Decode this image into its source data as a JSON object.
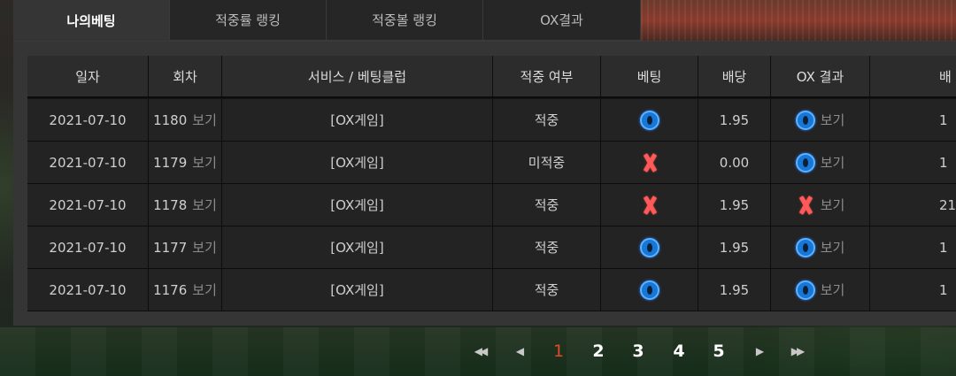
{
  "tabs": [
    {
      "label": "나의베팅",
      "active": true
    },
    {
      "label": "적중률 랭킹",
      "active": false
    },
    {
      "label": "적중볼 랭킹",
      "active": false
    },
    {
      "label": "OX결과",
      "active": false
    }
  ],
  "table": {
    "headers": [
      "일자",
      "회차",
      "서비스 / 베팅클럽",
      "적중 여부",
      "베팅",
      "배당",
      "OX 결과",
      "배"
    ],
    "view_label": "보기",
    "rows": [
      {
        "date": "2021-07-10",
        "round": "1180",
        "service": "[OX게임]",
        "hit": "적중",
        "bet": "O",
        "odds": "1.95",
        "ox_result": "O",
        "payout": "1"
      },
      {
        "date": "2021-07-10",
        "round": "1179",
        "service": "[OX게임]",
        "hit": "미적중",
        "bet": "X",
        "odds": "0.00",
        "ox_result": "O",
        "payout": "1"
      },
      {
        "date": "2021-07-10",
        "round": "1178",
        "service": "[OX게임]",
        "hit": "적중",
        "bet": "X",
        "odds": "1.95",
        "ox_result": "X",
        "payout": "21"
      },
      {
        "date": "2021-07-10",
        "round": "1177",
        "service": "[OX게임]",
        "hit": "적중",
        "bet": "O",
        "odds": "1.95",
        "ox_result": "O",
        "payout": "1"
      },
      {
        "date": "2021-07-10",
        "round": "1176",
        "service": "[OX게임]",
        "hit": "적중",
        "bet": "O",
        "odds": "1.95",
        "ox_result": "O",
        "payout": "1"
      }
    ]
  },
  "pagination": {
    "first_icon": "double-chevron-left-icon",
    "prev_icon": "chevron-left-icon",
    "pages": [
      "1",
      "2",
      "3",
      "4",
      "5"
    ],
    "current": "1",
    "next_icon": "chevron-right-icon",
    "last_icon": "double-chevron-right-icon"
  },
  "colors": {
    "o_icon": "#1677d8",
    "x_icon": "#ff5a5a",
    "current_page": "#e04a2a"
  }
}
